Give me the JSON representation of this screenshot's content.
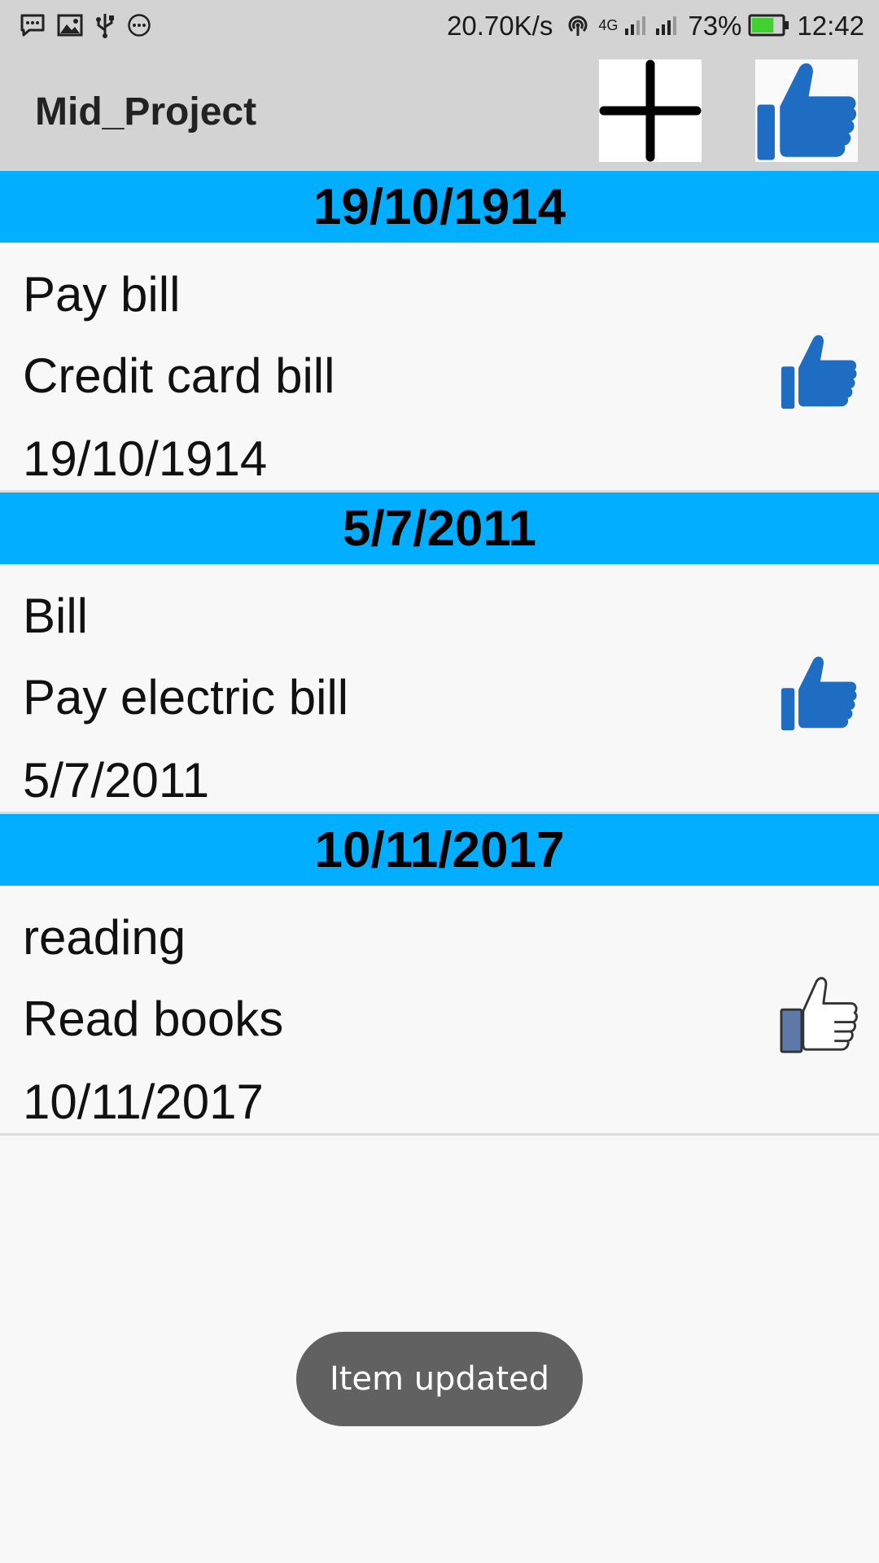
{
  "status_bar": {
    "net_speed": "20.70K/s",
    "network_type": "4G",
    "battery_percent": "73%",
    "battery_level": 0.73,
    "time": "12:42",
    "icons": [
      "message-icon",
      "image-icon",
      "usb-icon",
      "more-icon",
      "hotspot-icon",
      "signal-icon",
      "battery-icon"
    ],
    "battery_color": "#3fd12f"
  },
  "app_bar": {
    "title": "Mid_Project",
    "actions": [
      "add-icon",
      "thumbs-up-icon"
    ]
  },
  "list": {
    "header_color": "#02aeff",
    "accent_like_color": "#1f6dc2",
    "sections": [
      {
        "header": "19/10/1914",
        "item": {
          "title": "Pay bill",
          "description": "Credit card bill",
          "date": "19/10/1914",
          "liked": true
        }
      },
      {
        "header": "5/7/2011",
        "item": {
          "title": "Bill",
          "description": "Pay electric bill",
          "date": "5/7/2011",
          "liked": true
        }
      },
      {
        "header": "10/11/2017",
        "item": {
          "title": "reading",
          "description": "Read books",
          "date": "10/11/2017",
          "liked": false
        }
      }
    ]
  },
  "toast": {
    "message": "Item updated"
  }
}
